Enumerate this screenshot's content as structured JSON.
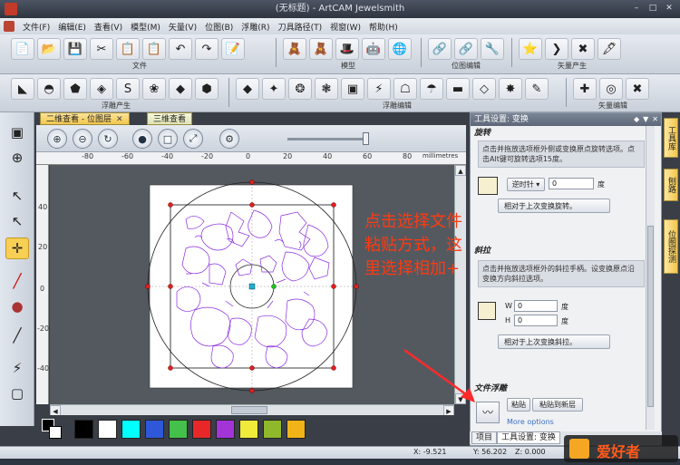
{
  "window": {
    "title": "(无标题) - ArtCAM Jewelsmith",
    "buttons": [
      "–",
      "□",
      "✕"
    ]
  },
  "menu": [
    "文件(F)",
    "编辑(E)",
    "查看(V)",
    "模型(M)",
    "矢量(V)",
    "位图(B)",
    "浮雕(R)",
    "刀具路径(T)",
    "视窗(W)",
    "帮助(H)"
  ],
  "toolbar1": {
    "file_label": "文件",
    "model_label": "模型",
    "relief_edit_label": "位图编辑",
    "vector_label": "矢量产生",
    "file_icons": [
      "📄",
      "📂",
      "💾",
      "✂",
      "📋",
      "📋",
      "↶",
      "↷",
      "📝"
    ],
    "model_icons": [
      "🧸",
      "🧸",
      "🎩",
      "🤖",
      "🌐"
    ],
    "relief_icons": [
      "🔗",
      "🔗",
      "🔧"
    ],
    "vector_icons": [
      "⭐",
      "❯",
      "✖",
      "🖋"
    ]
  },
  "toolbar2": {
    "relief_create_label": "浮雕产生",
    "relief_edit_label": "浮雕编辑",
    "vector_edit_label": "矢量编辑",
    "create_icons": [
      "◣",
      "◓",
      "⬟",
      "◈",
      "S",
      "❀",
      "◆",
      "⬢"
    ],
    "edit_icons": [
      "◆",
      "✦",
      "❂",
      "❃",
      "▣",
      "⚡",
      "☖",
      "☂",
      "▬",
      "◇",
      "✸",
      "✎"
    ],
    "vedit_icons": [
      "✚",
      "◎",
      "✖"
    ]
  },
  "left_tools": [
    "▣",
    "⊕",
    "↖",
    "↖",
    "✛",
    "╱",
    "●",
    "╱",
    "⚡",
    "▢"
  ],
  "doc_tabs": {
    "tab1": "二维查看 - 位图层",
    "tab2": "三维查看",
    "close": "✕"
  },
  "view_toolbar": [
    "⊕",
    "⊖",
    "↻",
    "●",
    "□",
    "⤢",
    "⚙"
  ],
  "ruler": {
    "h_ticks": [
      "-80",
      "-60",
      "-40",
      "-20",
      "0",
      "20",
      "40",
      "60",
      "80"
    ],
    "unit": "millimetres",
    "v_ticks": [
      "40",
      "20",
      "0",
      "-20",
      "-40"
    ]
  },
  "palette": [
    "#000000",
    "#ffffff",
    "#00ffff",
    "#2f58d8",
    "#43c14a",
    "#e82828",
    "#a334d8",
    "#f0ea3a",
    "#8fb82a",
    "#f0b418"
  ],
  "panel": {
    "header": "工具设置: 变换",
    "rotate": {
      "title": "旋转",
      "help": "点击并拖放选项框外侧或变换原点旋转选项。点击Alt键可旋转选项15度。",
      "direction": "逆时针",
      "angle": "0",
      "unit": "度",
      "reapply": "相对于上次变换旋转。"
    },
    "shear": {
      "title": "斜拉",
      "help": "点击并拖放选项框外的斜拉手柄。设变换原点沿变换方向斜拉选项。",
      "w_label": "W",
      "w_value": "0",
      "h_label": "H",
      "h_value": "0",
      "unit": "度",
      "reapply": "相对于上次变换斜拉。"
    },
    "paste": {
      "title": "文件浮雕",
      "paste_btn": "粘贴",
      "paste_new_btn": "粘贴到新层",
      "more": "More options"
    },
    "bottom_tabs": [
      "项目",
      "工具设置: 变换"
    ],
    "side_tabs": [
      "工具库",
      "刨路",
      "位图探测"
    ]
  },
  "annotation": "点击选择文件粘贴方式，这里选择相加+",
  "status": {
    "x": "X: -9.521",
    "y": "Y: 56.202",
    "z": "Z: 0.000"
  },
  "watermark": "爱好者"
}
